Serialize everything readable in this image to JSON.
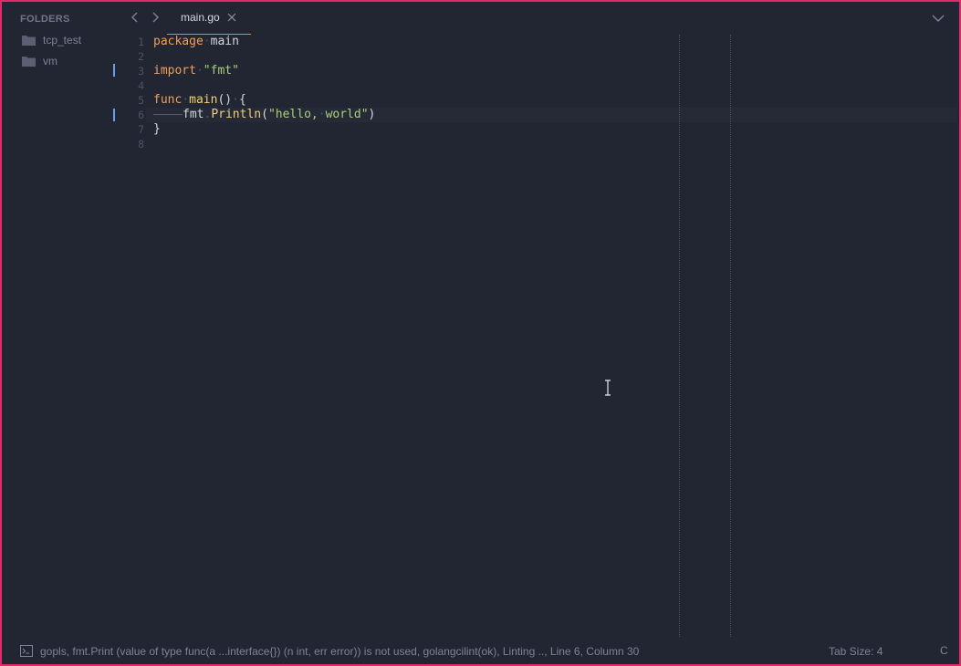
{
  "sidebar": {
    "title": "FOLDERS",
    "items": [
      {
        "label": "tcp_test",
        "icon": "folder-icon"
      },
      {
        "label": "vm",
        "icon": "folder-icon"
      }
    ]
  },
  "tabs": [
    {
      "label": "main.go",
      "active": true
    }
  ],
  "editor": {
    "line_numbers": [
      "1",
      "2",
      "3",
      "4",
      "5",
      "6",
      "7",
      "8"
    ],
    "active_line": 6,
    "modified_lines": [
      3,
      6
    ],
    "code": [
      "package main",
      "",
      "import \"fmt\"",
      "",
      "func main() {",
      "\tfmt.Println(\"hello, world\")",
      "}",
      ""
    ]
  },
  "status": {
    "message": "gopls, fmt.Print (value of type func(a ...interface{}) (n int, err error)) is not used, golangcilint(ok), Linting .., Line 6, Column 30",
    "tab_size": "Tab Size: 4",
    "extra": "C"
  },
  "colors": {
    "background": "#222633",
    "keyword": "#f0a05a",
    "string": "#a7d07a",
    "function": "#f2cf7a",
    "accent_border": "#e02a6a",
    "tab_underline": "#e08a3a"
  }
}
